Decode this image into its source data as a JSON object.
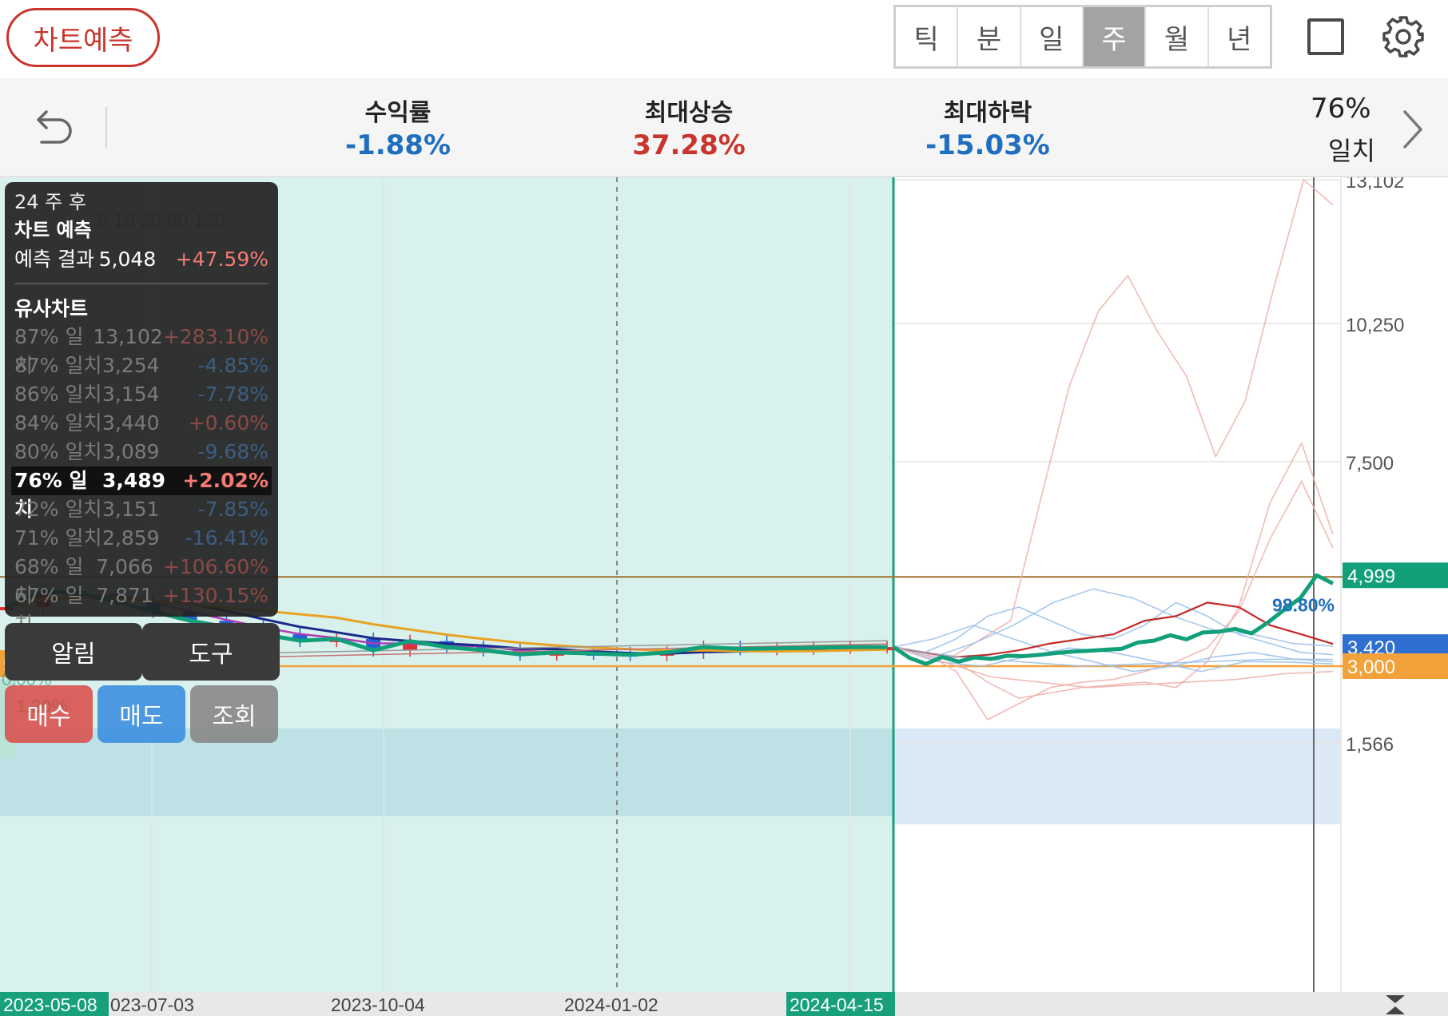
{
  "toolbar": {
    "prediction_button": "차트예측",
    "periods": [
      "틱",
      "분",
      "일",
      "주",
      "월",
      "년"
    ],
    "active_period": "주"
  },
  "stats": {
    "return": {
      "label": "수익률",
      "value": "-1.88%",
      "color": "#1f6fbf"
    },
    "max_rise": {
      "label": "최대상승",
      "value": "37.28%",
      "color": "#c8352d"
    },
    "max_fall": {
      "label": "최대하락",
      "value": "-15.03%",
      "color": "#1f6fbf"
    },
    "match_pct": "76%",
    "match_label": "일치"
  },
  "info_panel": {
    "after_label": "24 주 후",
    "title": "차트 예측",
    "result_label": "예측 결과",
    "result_value": "5,048",
    "result_pct": "+47.59%",
    "similar_title": "유사차트",
    "similar_rows": [
      {
        "match": "87% 일치",
        "value": "13,102",
        "pct": "+283.10%",
        "dir": "up"
      },
      {
        "match": "87% 일치",
        "value": "3,254",
        "pct": "-4.85%",
        "dir": "down"
      },
      {
        "match": "86% 일치",
        "value": "3,154",
        "pct": "-7.78%",
        "dir": "down"
      },
      {
        "match": "84% 일치",
        "value": "3,440",
        "pct": "+0.60%",
        "dir": "up"
      },
      {
        "match": "80% 일치",
        "value": "3,089",
        "pct": "-9.68%",
        "dir": "down"
      },
      {
        "match": "76% 일치",
        "value": "3,489",
        "pct": "+2.02%",
        "dir": "up",
        "selected": true
      },
      {
        "match": "72% 일치",
        "value": "3,151",
        "pct": "-7.85%",
        "dir": "down"
      },
      {
        "match": "71% 일치",
        "value": "2,859",
        "pct": "-16.41%",
        "dir": "down"
      },
      {
        "match": "68% 일치",
        "value": "7,066",
        "pct": "+106.60%",
        "dir": "up"
      },
      {
        "match": "67% 일치",
        "value": "7,871",
        "pct": "+130.15%",
        "dir": "up"
      }
    ]
  },
  "buttons": {
    "alert": "알림",
    "tools": "도구",
    "buy": "매수",
    "sell": "매도",
    "inquiry": "조회"
  },
  "chart_data": {
    "type": "line",
    "y_axis_ticks": [
      13102,
      10250,
      7500,
      1566
    ],
    "y_axis_tick_labels": [
      "13,102",
      "10,250",
      "7,500",
      "1,566"
    ],
    "price_tags": [
      {
        "label": "4,999",
        "value": 4999,
        "color": "#12a07a"
      },
      {
        "label": "3,420",
        "value": 3420,
        "color": "#2f6fd1"
      },
      {
        "label": "3,000",
        "value": 3000,
        "color": "#f2a23a"
      }
    ],
    "x_tick_labels": [
      "2023-05-08",
      "023-07-03",
      "2023-10-04",
      "2024-01-02",
      "2024-04-15"
    ],
    "overlay_texts": {
      "start_label": "544일 전",
      "start_pct": "1.20%",
      "end_pct": "98.80%",
      "ma_legend": "5 10 20 60 120",
      "top_left_faint": "0.00%"
    },
    "prediction_series": {
      "name": "",
      "color": "#12a07a",
      "values": [
        3420,
        3180,
        3050,
        3200,
        3100,
        3190,
        3160,
        3230,
        3220,
        3250,
        3290,
        3320,
        3340,
        3360,
        3380,
        3520,
        3560,
        3680,
        3590,
        3740,
        3760,
        3820,
        3720,
        3960,
        4240,
        4500,
        4999,
        4820
      ]
    },
    "history_series": {
      "name": "",
      "color": "#12a07a",
      "values": [
        4300,
        4650,
        4600,
        4420,
        4200,
        4000,
        3860,
        3700,
        3560,
        3600,
        3350,
        3550,
        3420,
        3350,
        3260,
        3300,
        3280,
        3250,
        3300,
        3420,
        3380,
        3390,
        3410,
        3420,
        3420
      ]
    },
    "similar_series": [
      {
        "values": [
          3420,
          3300,
          3200,
          3600,
          4000,
          6600,
          9000,
          10500,
          11200,
          10100,
          9200,
          7600,
          8700,
          11000,
          13102,
          12600
        ],
        "emphasis": "faint-red"
      },
      {
        "values": [
          3420,
          3300,
          2900,
          2000,
          2300,
          2600,
          2700,
          2750,
          2900,
          3100,
          3400,
          4200,
          5800,
          7066,
          5600
        ],
        "emphasis": "faint-red"
      },
      {
        "values": [
          3420,
          3300,
          3100,
          2700,
          2400,
          2500,
          2600,
          2650,
          2700,
          2600,
          3100,
          4300,
          6600,
          7871,
          5900
        ],
        "emphasis": "faint-red"
      },
      {
        "values": [
          3420,
          3300,
          3600,
          4100,
          4300,
          4000,
          3700,
          3600,
          3900,
          4400,
          4100,
          3700,
          3500,
          3300,
          3254
        ],
        "emphasis": "faint-blue"
      },
      {
        "values": [
          3420,
          3600,
          3900,
          3600,
          3300,
          3100,
          2900,
          3000,
          3200,
          3300,
          3154,
          3100
        ],
        "emphasis": "faint-blue"
      },
      {
        "values": [
          3420,
          3200,
          3500,
          3900,
          4400,
          4700,
          4500,
          4100,
          3800,
          3700,
          3500,
          3440
        ],
        "emphasis": "faint-blue"
      },
      {
        "values": [
          3420,
          3100,
          3000,
          3200,
          3400,
          3300,
          3100,
          2900,
          3100,
          3089,
          3050
        ],
        "emphasis": "faint-blue"
      },
      {
        "values": [
          3420,
          3300,
          3200,
          3250,
          3350,
          3500,
          3600,
          3700,
          4000,
          4100,
          4400,
          4300,
          3900,
          3700,
          3489
        ],
        "emphasis": "selected-red"
      },
      {
        "values": [
          3420,
          3200,
          3100,
          3000,
          3050,
          3100,
          3151,
          3150
        ],
        "emphasis": "faint-blue"
      },
      {
        "values": [
          3420,
          3100,
          2800,
          2700,
          2600,
          2650,
          2700,
          2750,
          2859,
          2900
        ],
        "emphasis": "faint-red"
      }
    ]
  }
}
